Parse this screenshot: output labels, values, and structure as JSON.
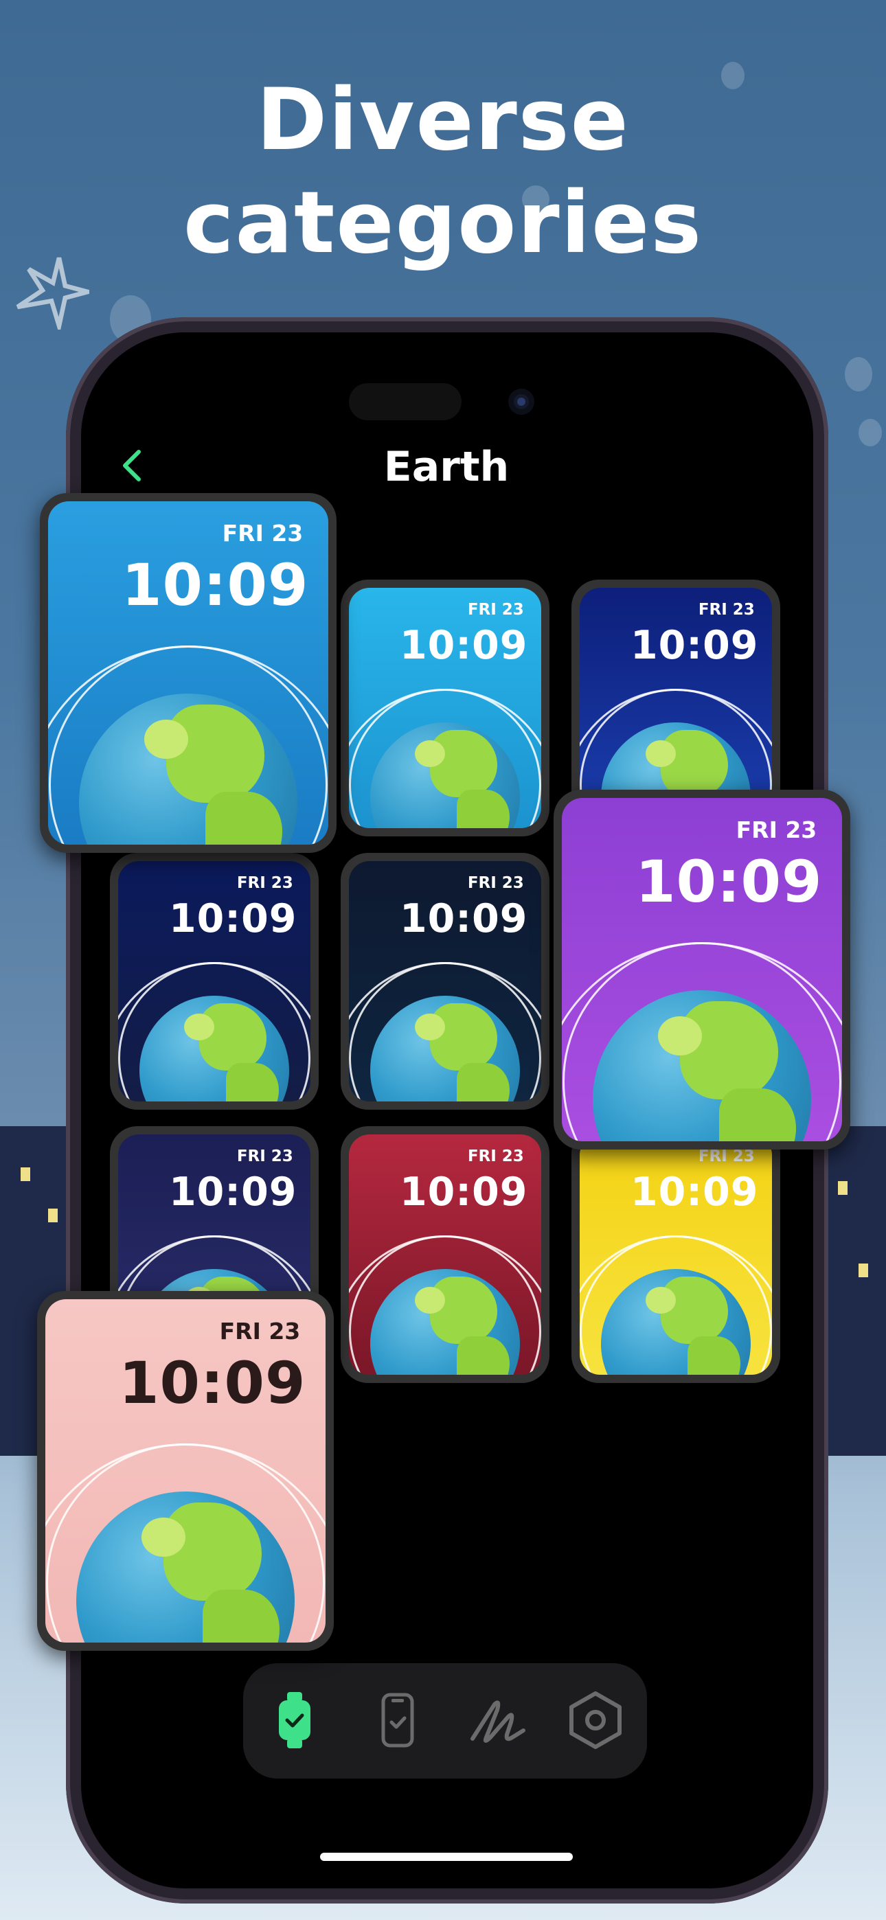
{
  "headline": {
    "line1": "Diverse",
    "line2": "categories"
  },
  "nav": {
    "title": "Earth",
    "back_glyph": "‹"
  },
  "watchfaces": [
    {
      "date": "FRI 23",
      "time": "10:09",
      "bg": "#2a9fe0",
      "bg2": "#1a7cc4",
      "label": "blue-sky"
    },
    {
      "date": "FRI 23",
      "time": "10:09",
      "bg": "#29b6ea",
      "bg2": "#1c93cf",
      "label": "light-blue"
    },
    {
      "date": "FRI 23",
      "time": "10:09",
      "bg": "#0d1f7a",
      "bg2": "#1b3fb0",
      "label": "deep-blue"
    },
    {
      "date": "FRI 23",
      "time": "10:09",
      "bg": "#0b1a5c",
      "bg2": "#131d46",
      "label": "night-stars"
    },
    {
      "date": "FRI 23",
      "time": "10:09",
      "bg": "#0d1930",
      "bg2": "#0f2540",
      "label": "dark-navy"
    },
    {
      "date": "FRI 23",
      "time": "10:09",
      "bg": "#8d3fd4",
      "bg2": "#a94ee0",
      "label": "purple"
    },
    {
      "date": "FRI 23",
      "time": "10:09",
      "bg": "#1c1f55",
      "bg2": "#2a2d6a",
      "label": "confetti"
    },
    {
      "date": "FRI 23",
      "time": "10:09",
      "bg": "#b5283f",
      "bg2": "#7a1728",
      "label": "red-rain"
    },
    {
      "date": "FRI 23",
      "time": "10:09",
      "bg": "#f4d214",
      "bg2": "#f7e33e",
      "label": "yellow-sunburst"
    },
    {
      "date": "FRI 23",
      "time": "10:09",
      "bg": "#f6c7c4",
      "bg2": "#f2b8b5",
      "label": "pink-stars",
      "dark_text": true
    }
  ],
  "tabbar": {
    "items": [
      {
        "icon": "watch-icon",
        "active": true
      },
      {
        "icon": "phone-icon",
        "active": false
      },
      {
        "icon": "scribble-icon",
        "active": false
      },
      {
        "icon": "settings-hexagon-icon",
        "active": false
      }
    ],
    "active_color": "#3ee08a",
    "inactive_color": "#6b6b6b"
  }
}
